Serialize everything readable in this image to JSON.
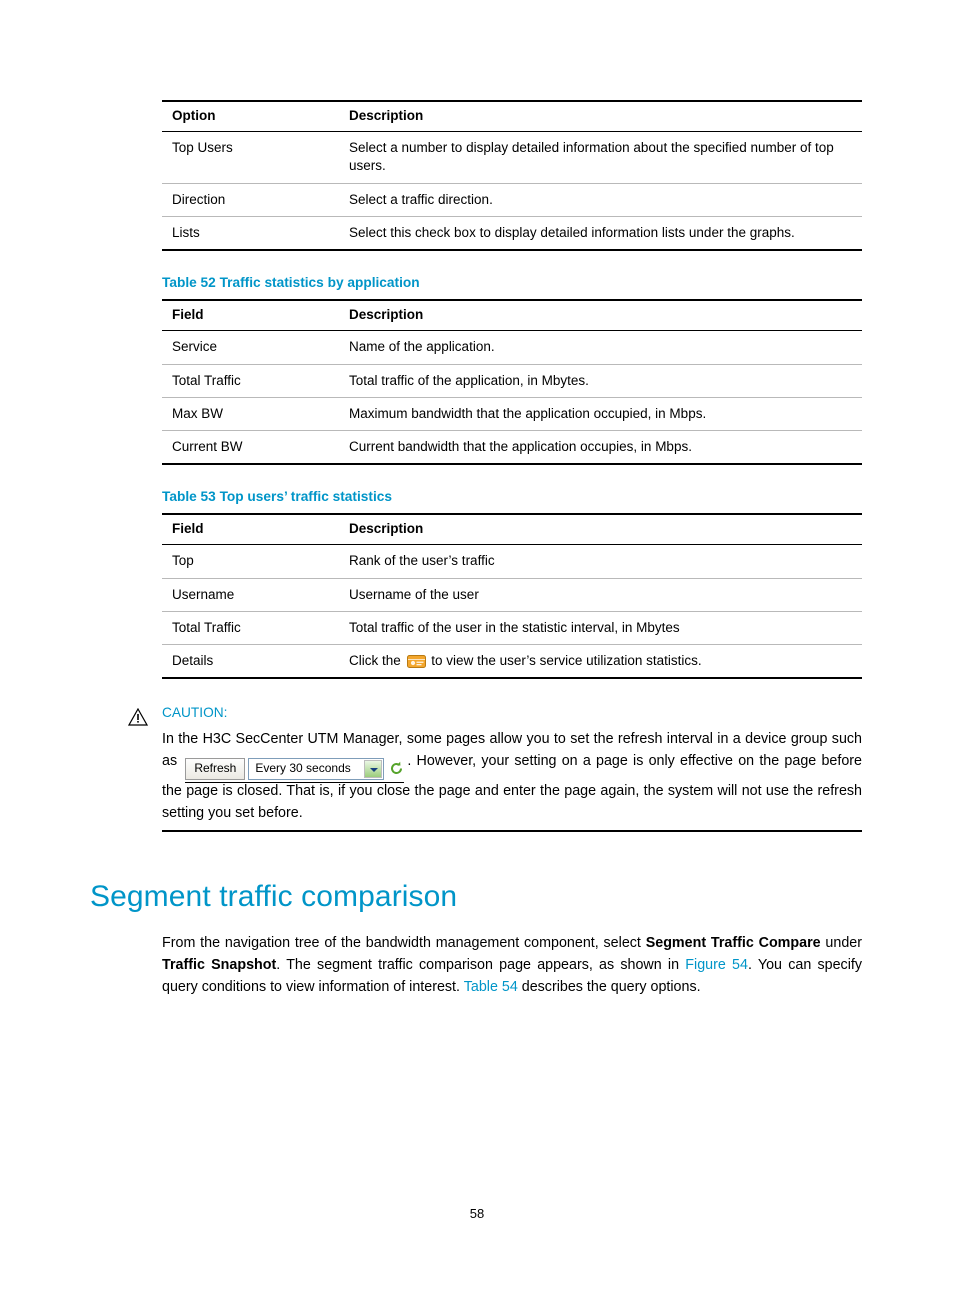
{
  "table51": {
    "headers": [
      "Option",
      "Description"
    ],
    "rows": [
      [
        "Top Users",
        "Select a number to display detailed information about the specified number of top users."
      ],
      [
        "Direction",
        "Select a traffic direction."
      ],
      [
        "Lists",
        "Select this check box to display detailed information lists under the graphs."
      ]
    ]
  },
  "table52": {
    "caption": "Table 52 Traffic statistics by application",
    "headers": [
      "Field",
      "Description"
    ],
    "rows": [
      [
        "Service",
        "Name of the application."
      ],
      [
        "Total Traffic",
        "Total traffic of the application, in Mbytes."
      ],
      [
        "Max BW",
        "Maximum bandwidth that the application occupied, in Mbps."
      ],
      [
        "Current BW",
        "Current bandwidth that the application occupies, in Mbps."
      ]
    ]
  },
  "table53": {
    "caption": "Table 53 Top users’ traffic statistics",
    "headers": [
      "Field",
      "Description"
    ],
    "rows": [
      [
        "Top",
        "Rank of the user’s traffic"
      ],
      [
        "Username",
        "Username of the user"
      ],
      [
        "Total Traffic",
        "Total traffic of the user in the statistic interval, in Mbytes"
      ]
    ],
    "details_row": {
      "label": "Details",
      "text_before": "Click the",
      "text_after": "to view the user’s service utilization statistics."
    }
  },
  "caution": {
    "title": "CAUTION:",
    "text_part1": "In the H3C SecCenter UTM Manager, some pages allow you to set the refresh interval in a device group such as",
    "text_part2": ". However, your setting on a page is only effective on the page before the page is closed. That is, if you close the page and enter the page again, the system will not use the refresh setting you set before.",
    "widget": {
      "button_label": "Refresh",
      "select_value": "Every 30 seconds"
    }
  },
  "section": {
    "title": "Segment traffic comparison",
    "para_1": "From the navigation tree of the bandwidth management component, select ",
    "para_bold_1": "Segment Traffic Compare",
    "para_2": " under ",
    "para_bold_2": "Traffic Snapshot",
    "para_3": ". The segment traffic comparison page appears, as shown in ",
    "para_link_1": "Figure 54",
    "para_4": ". You can specify query conditions to view information of interest. ",
    "para_link_2": "Table 54",
    "para_5": " describes the query options."
  },
  "footer": {
    "page_number": "58"
  },
  "colors": {
    "accent": "#0095c8",
    "rule": "#000000"
  }
}
